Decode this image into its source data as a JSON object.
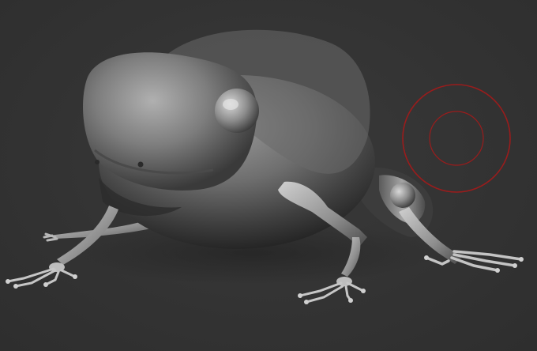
{
  "viewport": {
    "background_color": "#333333",
    "model_color": "#8a8a8a",
    "brush_cursor_color": "#9a1c1c"
  },
  "scene": {
    "subject_icon": "frog-sculpt-icon",
    "brush_icon": "brush-cursor-icon"
  }
}
